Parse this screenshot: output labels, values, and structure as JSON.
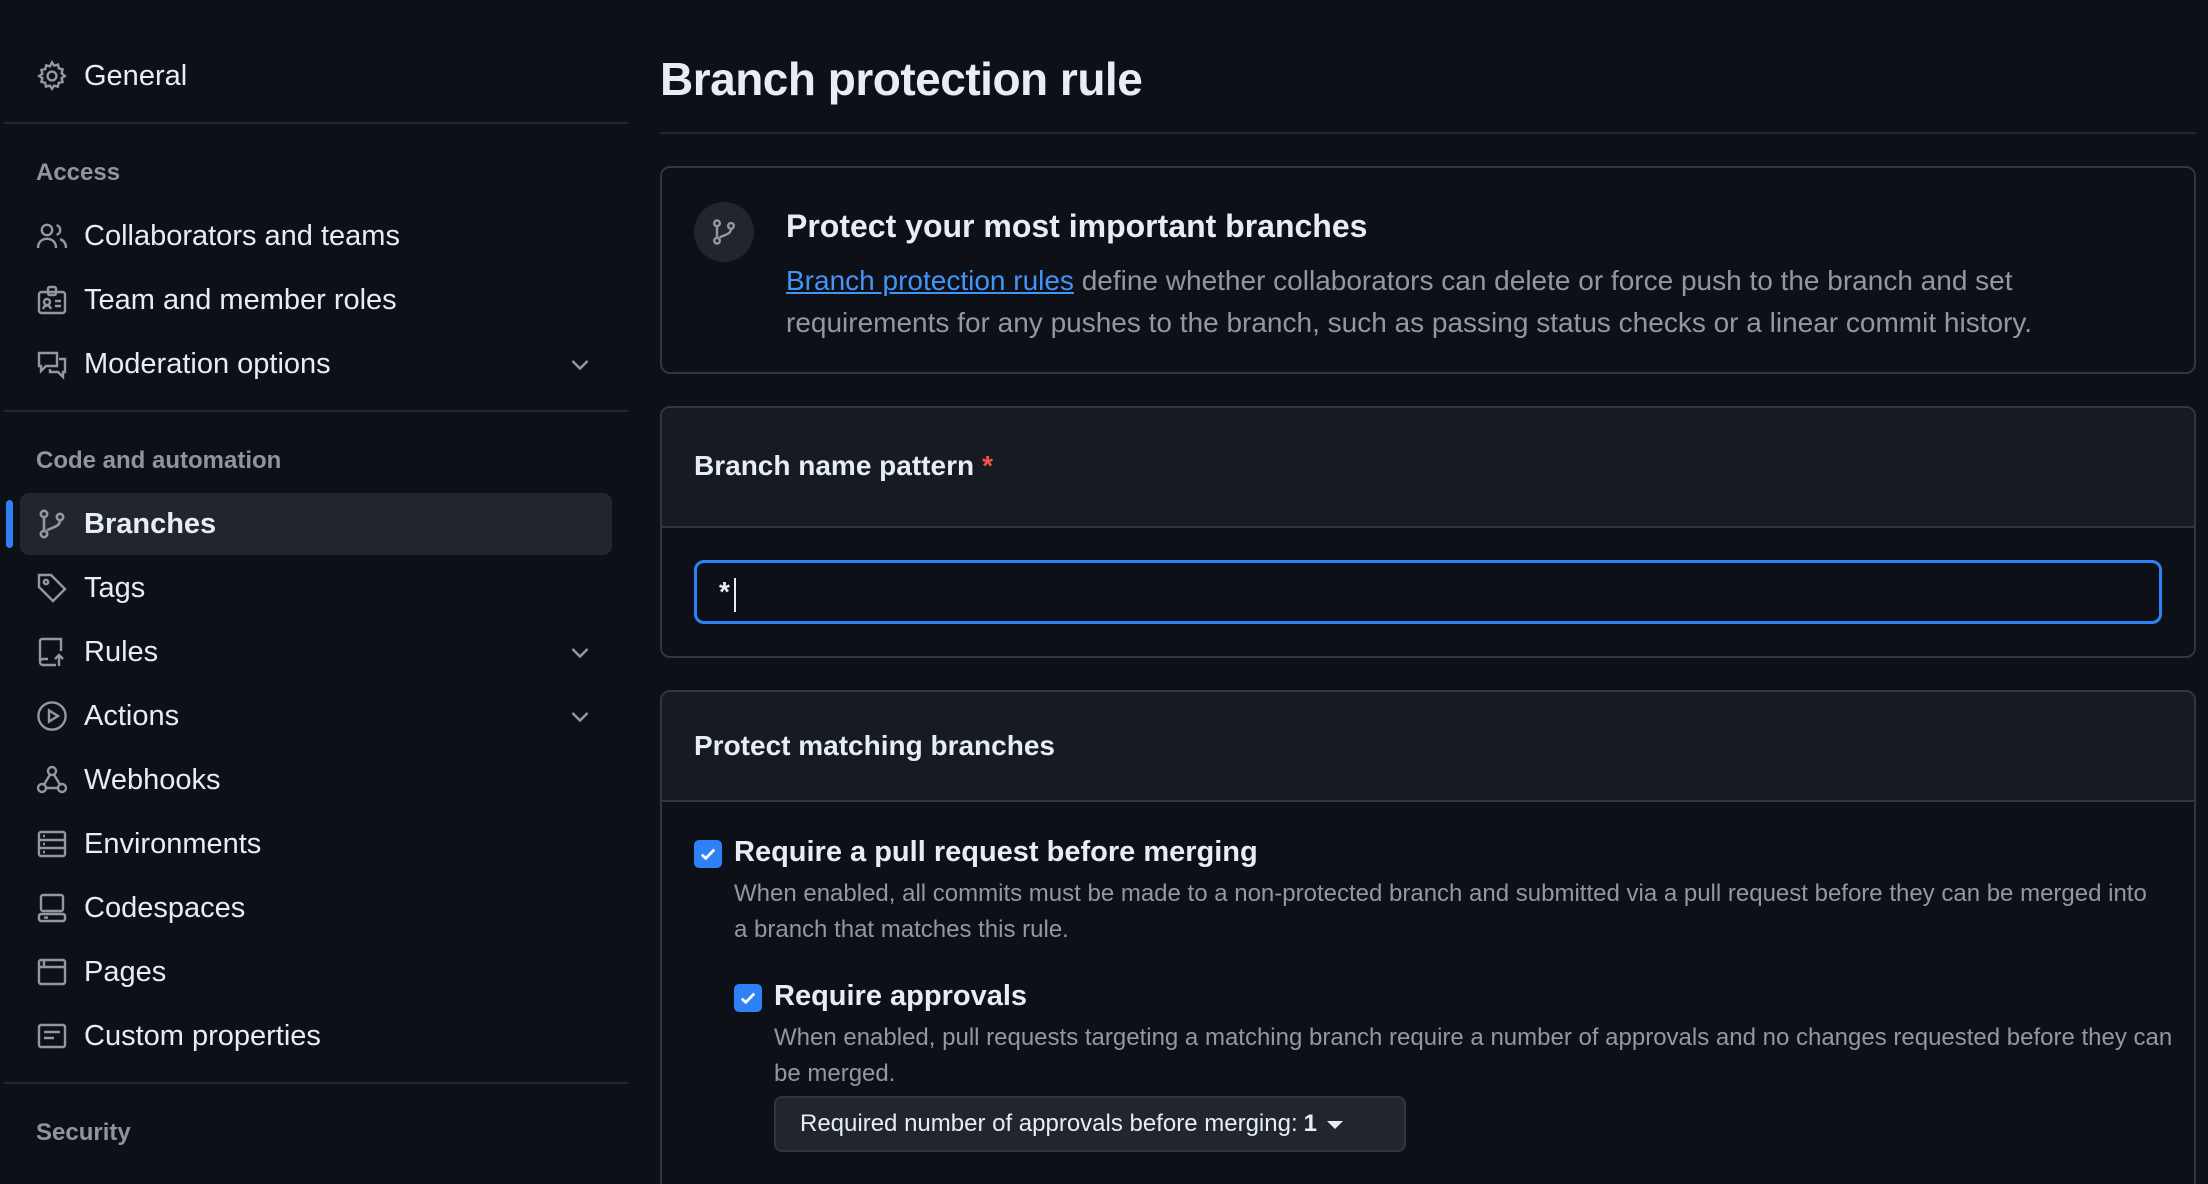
{
  "sidebar": {
    "general": {
      "label": "General",
      "icon": "gear-icon"
    },
    "sections": [
      {
        "heading": "Access"
      },
      {
        "heading": "Code and automation"
      },
      {
        "heading": "Security"
      }
    ],
    "items": [
      {
        "label": "Collaborators and teams",
        "icon": "people-icon"
      },
      {
        "label": "Team and member roles",
        "icon": "id-badge-icon"
      },
      {
        "label": "Moderation options",
        "icon": "comment-discussion-icon",
        "expandable": true
      },
      {
        "label": "Branches",
        "icon": "git-branch-icon",
        "active": true
      },
      {
        "label": "Tags",
        "icon": "tag-icon"
      },
      {
        "label": "Rules",
        "icon": "repo-push-icon",
        "expandable": true
      },
      {
        "label": "Actions",
        "icon": "play-icon",
        "expandable": true
      },
      {
        "label": "Webhooks",
        "icon": "webhook-icon"
      },
      {
        "label": "Environments",
        "icon": "server-icon"
      },
      {
        "label": "Codespaces",
        "icon": "codespaces-icon"
      },
      {
        "label": "Pages",
        "icon": "browser-icon"
      },
      {
        "label": "Custom properties",
        "icon": "note-icon"
      }
    ]
  },
  "main": {
    "title": "Branch protection rule",
    "info": {
      "icon": "git-branch-icon",
      "title": "Protect your most important branches",
      "link_text": "Branch protection rules",
      "desc_rest": " define whether collaborators can delete or force push to the branch and set requirements for any pushes to the branch, such as passing status checks or a linear commit history."
    },
    "pattern": {
      "label": "Branch name pattern",
      "required_mark": "*",
      "value": "*"
    },
    "protect": {
      "heading": "Protect matching branches",
      "options": [
        {
          "title": "Require a pull request before merging",
          "checked": true,
          "desc": "When enabled, all commits must be made to a non-protected branch and submitted via a pull request before they can be merged into a branch that matches this rule."
        },
        {
          "title": "Require approvals",
          "checked": true,
          "desc": "When enabled, pull requests targeting a matching branch require a number of approvals and no changes requested before they can be merged."
        }
      ],
      "approvals_select": {
        "label": "Required number of approvals before merging:",
        "value": "1"
      }
    }
  },
  "colors": {
    "accent": "#2f81f7",
    "link": "#4493f8",
    "background": "#0d1117",
    "danger": "#f85149"
  }
}
